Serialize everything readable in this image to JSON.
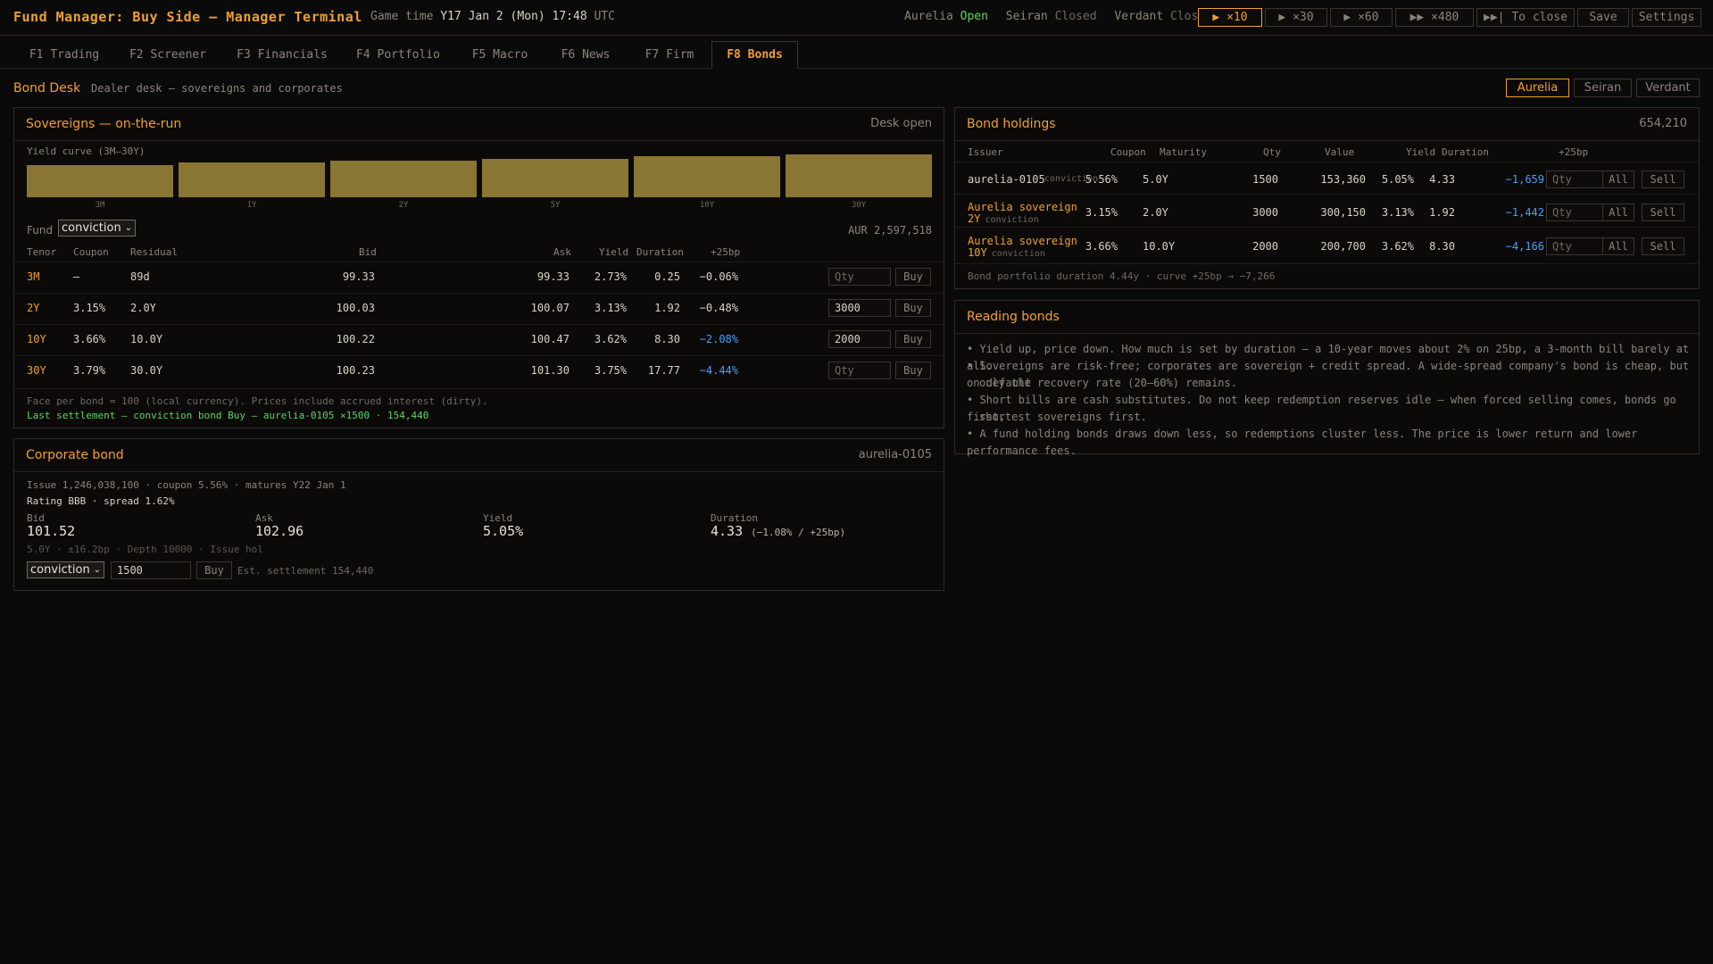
{
  "app": {
    "title": "Fund Manager: Buy Side — Manager Terminal",
    "game_time_label": "Game time",
    "game_time_value": "Y17 Jan 2 (Mon) 17:48",
    "tz": "UTC"
  },
  "markets": [
    {
      "name": "Aurelia",
      "status": "Open"
    },
    {
      "name": "Seiran",
      "status": "Closed"
    },
    {
      "name": "Verdant",
      "status": "Closed"
    }
  ],
  "controls": {
    "speed_10": "▶ ×10",
    "speed_30": "▶ ×30",
    "speed_60": "▶ ×60",
    "speed_480": "▶▶ ×480",
    "to_close": "▶▶| To close",
    "save": "Save",
    "settings": "Settings"
  },
  "tabs": [
    "F1 Trading",
    "F2 Screener",
    "F3 Financials",
    "F4 Portfolio",
    "F5 Macro",
    "F6 News",
    "F7 Firm",
    "F8 Bonds"
  ],
  "desk": {
    "title": "Bond Desk",
    "subtitle": "Dealer desk — sovereigns and corporates",
    "funds": [
      "Aurelia",
      "Seiran",
      "Verdant"
    ]
  },
  "sovereigns": {
    "title": "Sovereigns — on-the-run",
    "status": "Desk open",
    "curve_label": "Yield curve (3M–30Y)",
    "curve": {
      "tenors": [
        "3M",
        "1Y",
        "2Y",
        "5Y",
        "10Y",
        "30Y"
      ],
      "yields": [
        2.73,
        2.95,
        3.13,
        3.35,
        3.62,
        3.75
      ]
    },
    "fund_label": "Fund",
    "fund_value": "conviction",
    "cash": "AUR 2,597,518",
    "headers": [
      "Tenor",
      "Coupon",
      "Residual",
      "Bid",
      "Ask",
      "Yield",
      "Duration",
      "+25bp"
    ],
    "rows": [
      {
        "tenor": "3M",
        "coupon": "—",
        "residual": "89d",
        "bid": "99.33",
        "ask": "99.33",
        "yield": "2.73%",
        "duration": "0.25",
        "bp25": "−0.06%",
        "qty": "",
        "buy": "Buy"
      },
      {
        "tenor": "2Y",
        "coupon": "3.15%",
        "residual": "2.0Y",
        "bid": "100.03",
        "ask": "100.07",
        "yield": "3.13%",
        "duration": "1.92",
        "bp25": "−0.48%",
        "qty": "3000",
        "buy": "Buy"
      },
      {
        "tenor": "10Y",
        "coupon": "3.66%",
        "residual": "10.0Y",
        "bid": "100.22",
        "ask": "100.47",
        "yield": "3.62%",
        "duration": "8.30",
        "bp25": "−2.08%",
        "qty": "2000",
        "buy": "Buy"
      },
      {
        "tenor": "30Y",
        "coupon": "3.79%",
        "residual": "30.0Y",
        "bid": "100.23",
        "ask": "101.30",
        "yield": "3.75%",
        "duration": "17.77",
        "bp25": "−4.44%",
        "qty": "",
        "buy": "Buy"
      }
    ],
    "qty_placeholder": "Qty",
    "footnote": "Face per bond = 100 (local currency). Prices include accrued interest (dirty).",
    "settlement": "Last settlement — conviction bond Buy — aurelia-0105 ×1500 · 154,440"
  },
  "corporate": {
    "title": "Corporate bond",
    "id": "aurelia-0105",
    "issue_line": "Issue 1,246,038,100 · coupon 5.56% · matures Y22 Jan 1",
    "rating_line": "Rating BBB · spread 1.62%",
    "bid_label": "Bid",
    "bid": "101.52",
    "ask_label": "Ask",
    "ask": "102.96",
    "yield_label": "Yield",
    "yield": "5.05%",
    "duration_label": "Duration",
    "duration": "4.33",
    "duration_note": "(−1.08% / +25bp)",
    "meta": "5.0Y · ±16.2bp · Depth 10000 · Issue hol",
    "fund_value": "conviction",
    "qty": "1500",
    "buy": "Buy",
    "est": "Est. settlement 154,440"
  },
  "holdings": {
    "title": "Bond holdings",
    "total": "654,210",
    "headers": [
      "Issuer",
      "Coupon",
      "Maturity",
      "Qty",
      "Value",
      "Yield",
      "Duration",
      "+25bp"
    ],
    "rows": [
      {
        "issuer": "aurelia-0105",
        "issuer2": "",
        "fund": "conviction",
        "coupon": "5.56%",
        "maturity": "5.0Y",
        "qty": "1500",
        "value": "153,360",
        "yield": "5.05%",
        "duration": "4.33",
        "bp25": "−1,659"
      },
      {
        "issuer": "Aurelia sovereign",
        "issuer2": "2Y",
        "fund": "conviction",
        "coupon": "3.15%",
        "maturity": "2.0Y",
        "qty": "3000",
        "value": "300,150",
        "yield": "3.13%",
        "duration": "1.92",
        "bp25": "−1,442"
      },
      {
        "issuer": "Aurelia sovereign",
        "issuer2": "10Y",
        "fund": "conviction",
        "coupon": "3.66%",
        "maturity": "10.0Y",
        "qty": "2000",
        "value": "200,700",
        "yield": "3.62%",
        "duration": "8.30",
        "bp25": "−4,166"
      }
    ],
    "qty_placeholder": "Qty",
    "all": "All",
    "sell": "Sell",
    "footer": "Bond portfolio duration 4.44y · curve +25bp → −7,266"
  },
  "reading": {
    "title": "Reading bonds",
    "notes": [
      "• Yield up, price down. How much is set by duration — a 10-year moves about 2% on 25bp, a 3-month bill barely at all.",
      "• Sovereigns are risk-free; corporates are sovereign + credit spread. A wide-spread company's bond is cheap, but on default",
      "only the recovery rate (20–60%) remains.",
      "• Short bills are cash substitutes. Do not keep redemption reserves idle — when forced selling comes, bonds go first,",
      "shortest sovereigns first.",
      "• A fund holding bonds draws down less, so redemptions cluster less. The price is lower return and lower performance fees."
    ]
  },
  "colors": {
    "accent": "#f0a030",
    "open": "#5fd35f",
    "negative": "#4a9eff",
    "bar": "#8a7634"
  }
}
